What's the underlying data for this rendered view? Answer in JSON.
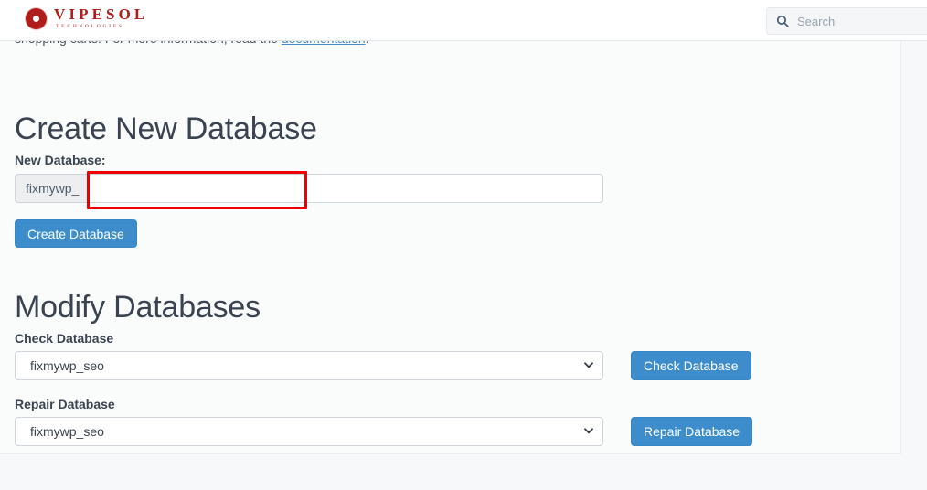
{
  "header": {
    "logo": {
      "name": "VIPESOL",
      "tagline": "TECHNOLOGIES",
      "mark_color": "#b01c1c"
    },
    "search": {
      "placeholder": "Search",
      "value": "",
      "icon": "search-icon"
    }
  },
  "intro": {
    "text_before": "shopping carts. For more information, read the ",
    "link_text": "documentation",
    "text_after": "."
  },
  "create_section": {
    "title": "Create New Database",
    "new_database_label": "New Database:",
    "prefix": "fixmywp_",
    "input_value": "",
    "input_placeholder": "",
    "create_button": "Create Database"
  },
  "modify_section": {
    "title": "Modify Databases",
    "check": {
      "label": "Check Database",
      "selected": "fixmywp_seo",
      "options": [
        "fixmywp_seo"
      ],
      "button": "Check Database",
      "chevron": "chevron-down-icon"
    },
    "repair": {
      "label": "Repair Database",
      "selected": "fixmywp_seo",
      "options": [
        "fixmywp_seo"
      ],
      "button": "Repair Database",
      "chevron": "chevron-down-icon"
    }
  },
  "annotation": {
    "highlight_color": "#ee0000",
    "target": "new-database-name-input"
  },
  "colors": {
    "primary_button": "#3d8dcc",
    "page_background": "#f7f8f9",
    "brand_red": "#b01c1c",
    "link_blue": "#4a89c8"
  }
}
